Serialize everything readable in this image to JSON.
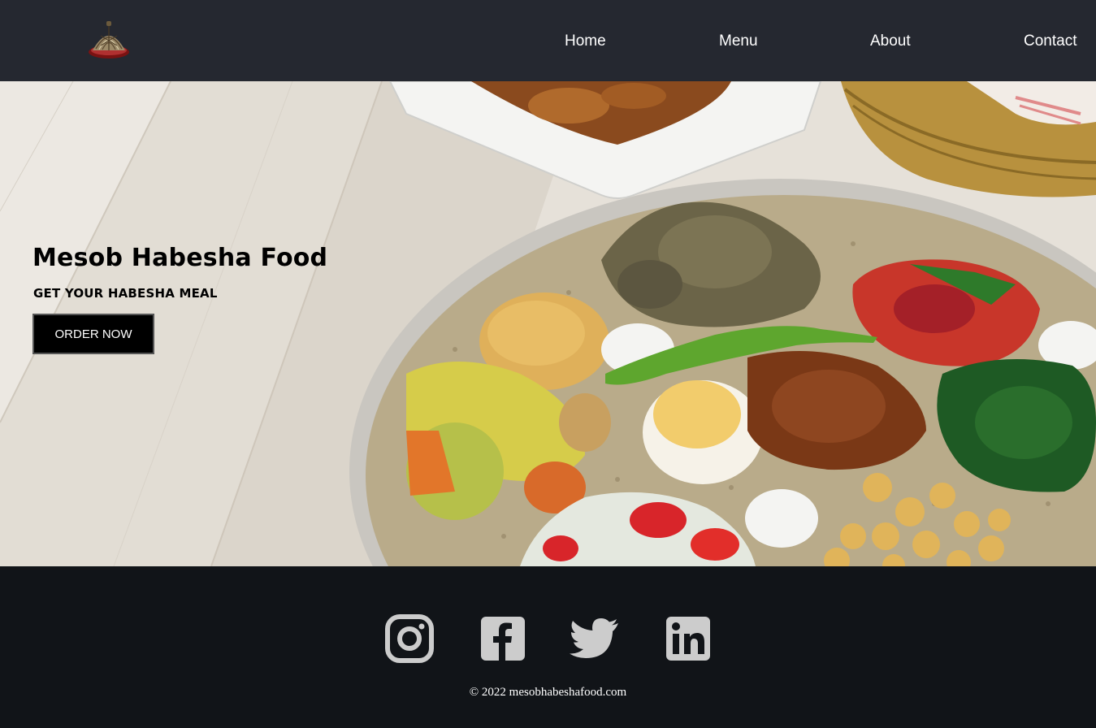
{
  "nav": {
    "logo_icon": "mesob-basket-icon",
    "links": [
      {
        "label": "Home"
      },
      {
        "label": "Menu"
      },
      {
        "label": "About"
      },
      {
        "label": "Contact"
      }
    ],
    "background": "#252830"
  },
  "hero": {
    "title": "Mesob Habesha Food",
    "subtitle": "GET YOUR HABESHA MEAL",
    "cta_label": "ORDER NOW",
    "image_icon": "injera-platter-photo"
  },
  "footer": {
    "social": [
      {
        "icon": "instagram-icon"
      },
      {
        "icon": "facebook-icon"
      },
      {
        "icon": "twitter-icon"
      },
      {
        "icon": "linkedin-icon"
      }
    ],
    "copyright": "© 2022 mesobhabeshafood.com",
    "icon_color": "#cccccc",
    "background": "#111418"
  }
}
